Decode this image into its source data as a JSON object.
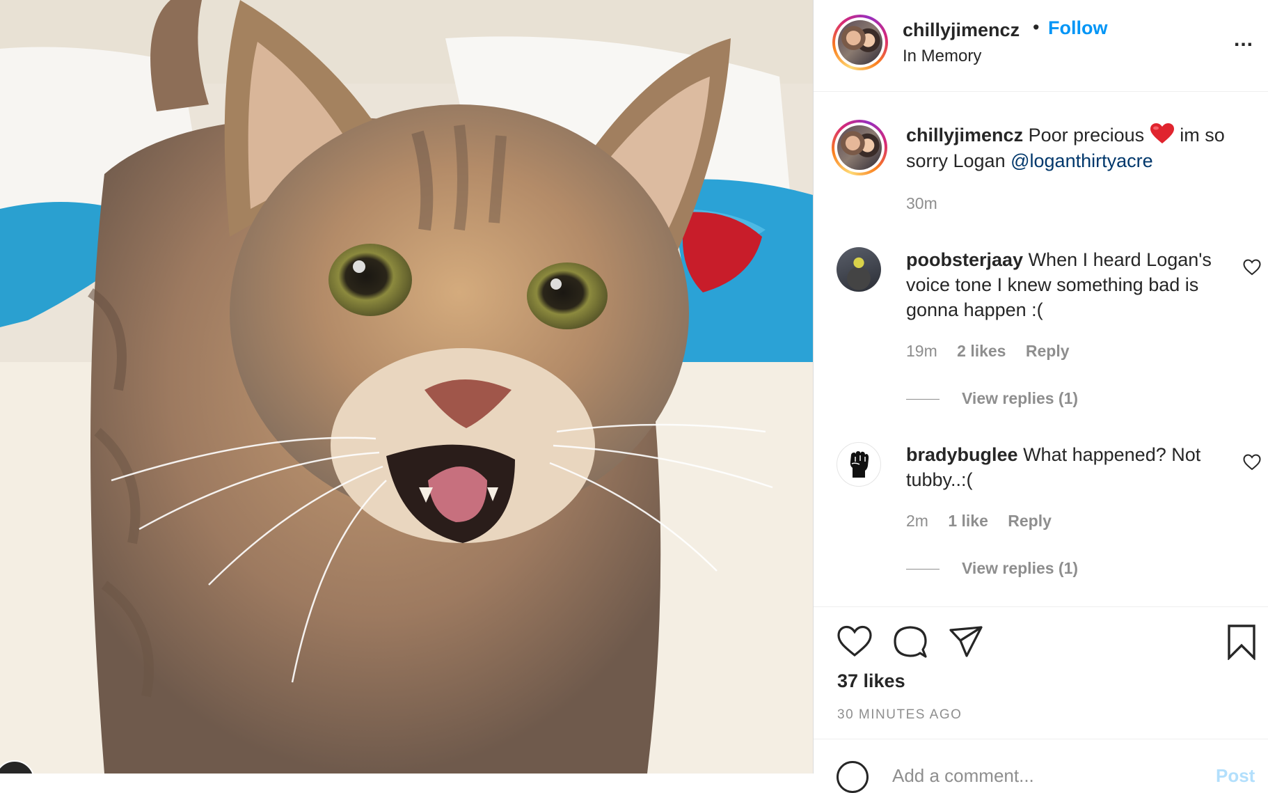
{
  "post": {
    "colors": {
      "follow": "#0095f6",
      "mention": "#00376b",
      "muted": "#8e8e8e",
      "text": "#262626"
    }
  },
  "header": {
    "username": "chillyjimencz",
    "bullet": "•",
    "follow_label": "Follow",
    "location": "In Memory",
    "more_label": "..."
  },
  "caption": {
    "username": "chillyjimencz",
    "text_before": "Poor precious",
    "emoji_icon": "red-heart-emoji",
    "text_after": "im so sorry Logan",
    "mention": "@loganthirtyacre",
    "time": "30m"
  },
  "comments": [
    {
      "username": "poobsterjaay",
      "text": "When I heard Logan's voice tone I knew something bad is gonna happen :(",
      "time": "19m",
      "likes": "2 likes",
      "reply_label": "Reply",
      "view_replies": "View replies (1)"
    },
    {
      "username": "bradybuglee",
      "text": "What happened? Not tubby..:(",
      "time": "2m",
      "likes": "1 like",
      "reply_label": "Reply",
      "view_replies": "View replies (1)"
    }
  ],
  "actions": {
    "likes": "37 likes",
    "posted_ago": "30 MINUTES AGO",
    "icons": [
      "heart-icon",
      "comment-icon",
      "share-icon",
      "bookmark-icon"
    ]
  },
  "comment_box": {
    "placeholder": "Add a comment...",
    "post_label": "Post"
  }
}
